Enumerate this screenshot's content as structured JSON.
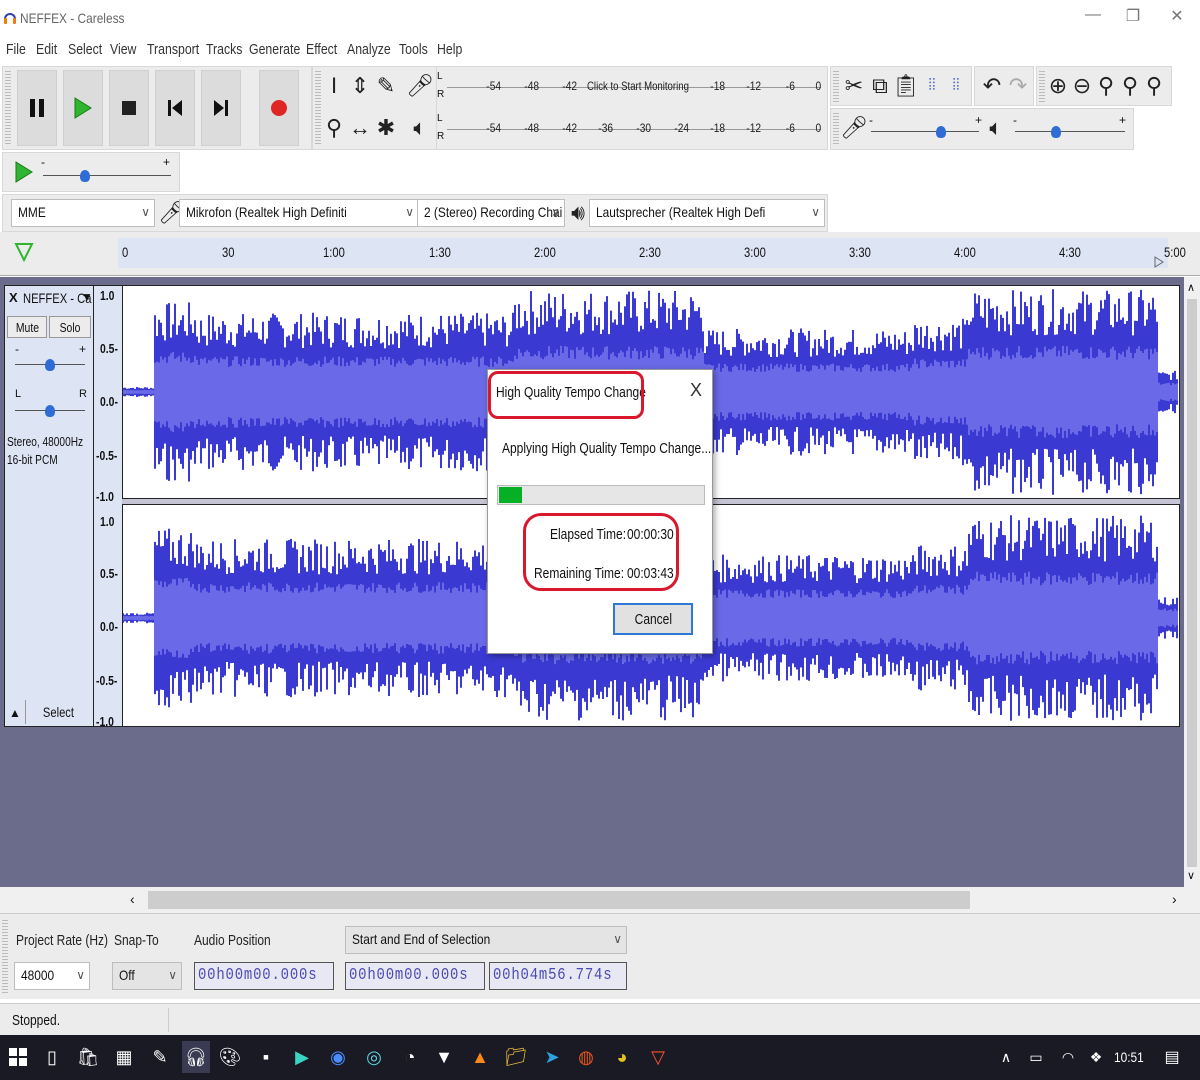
{
  "window": {
    "title": "NEFFEX - Careless",
    "minimize": "—",
    "maximize": "❐",
    "close": "✕"
  },
  "menu": [
    "File",
    "Edit",
    "Select",
    "View",
    "Transport",
    "Tracks",
    "Generate",
    "Effect",
    "Analyze",
    "Tools",
    "Help"
  ],
  "meter": {
    "record_ticks": [
      "-54",
      "-48",
      "-42",
      "-18",
      "-12",
      "-6",
      "0"
    ],
    "monitor_label": "Click to Start Monitoring",
    "play_ticks": [
      "-54",
      "-48",
      "-42",
      "-36",
      "-30",
      "-24",
      "-18",
      "-12",
      "-6",
      "0"
    ],
    "lr": [
      "L",
      "R"
    ]
  },
  "device": {
    "host": "MME",
    "mic": "Mikrofon (Realtek High Definiti",
    "channels": "2 (Stereo) Recording Chai",
    "speaker": "Lautsprecher (Realtek High Defi"
  },
  "ruler": {
    "labels": [
      "0",
      "30",
      "1:00",
      "1:30",
      "2:00",
      "2:30",
      "3:00",
      "3:30",
      "4:00",
      "4:30",
      "5:00"
    ]
  },
  "track": {
    "name": "NEFFEX - Ca",
    "close": "X",
    "mute": "Mute",
    "solo": "Solo",
    "gain_minus": "-",
    "gain_plus": "+",
    "pan_l": "L",
    "pan_r": "R",
    "info_line1": "Stereo, 48000Hz",
    "info_line2": "16-bit PCM",
    "select": "Select",
    "vscale": [
      "1.0",
      "0.5-",
      "0.0-",
      "-0.5-",
      "-1.0"
    ],
    "wave_color": "#3a3ad2"
  },
  "dialog": {
    "title": "High Quality Tempo Change",
    "close": "X",
    "message": "Applying High Quality Tempo Change...",
    "progress": 0.11,
    "elapsed_label": "Elapsed Time:",
    "elapsed_value": "00:00:30",
    "remaining_label": "Remaining Time:",
    "remaining_value": "00:03:43",
    "cancel": "Cancel",
    "highlight_color": "#d9182e"
  },
  "selection": {
    "project_rate_label": "Project Rate (Hz)",
    "project_rate": "48000",
    "snap_label": "Snap-To",
    "snap": "Off",
    "audio_pos_label": "Audio Position",
    "audio_pos": "00h00m00.000s",
    "mode": "Start and End of Selection",
    "start": "00h00m00.000s",
    "end": "00h04m56.774s"
  },
  "status": "Stopped.",
  "taskbar": {
    "time": "10:51"
  }
}
